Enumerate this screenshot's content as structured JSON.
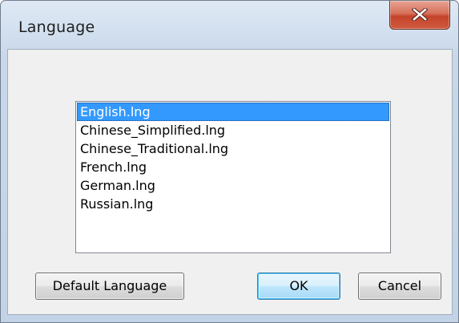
{
  "window": {
    "title": "Language",
    "close_icon": "close-x-icon"
  },
  "language_list": {
    "selected_index": 0,
    "items": [
      "English.lng",
      "Chinese_Simplified.lng",
      "Chinese_Traditional.lng",
      "French.lng",
      "German.lng",
      "Russian.lng"
    ]
  },
  "buttons": {
    "default_language": "Default Language",
    "ok": "OK",
    "cancel": "Cancel"
  },
  "colors": {
    "selection": "#3399ff",
    "close_button": "#c4432a"
  }
}
